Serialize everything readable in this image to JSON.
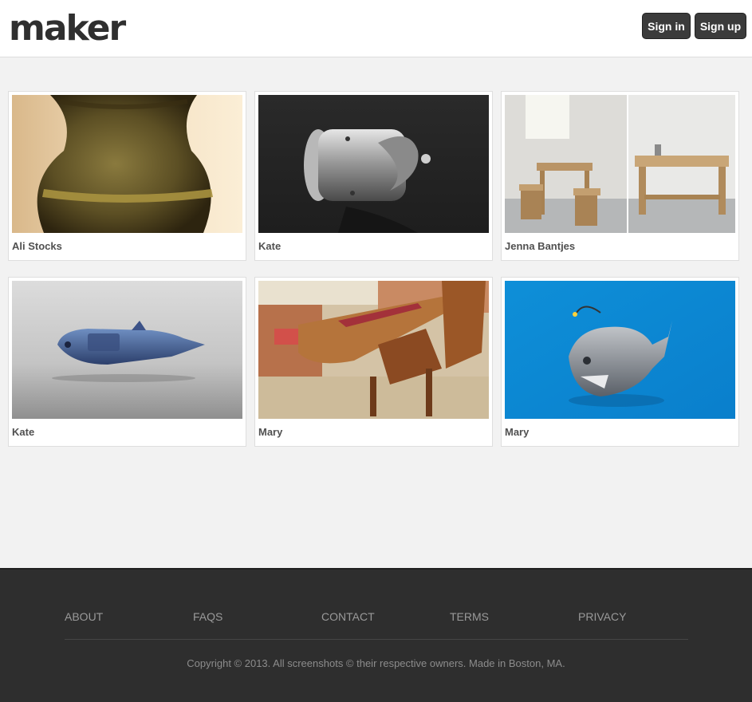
{
  "header": {
    "logo": "maker",
    "signin_label": "Sign in",
    "signup_label": "Sign up"
  },
  "gallery": {
    "items": [
      {
        "author": "Ali Stocks",
        "image": "pottery-vase"
      },
      {
        "author": "Kate",
        "image": "metal-propeller-part"
      },
      {
        "author": "Jenna Bantjes",
        "image": "wooden-table-and-stools"
      },
      {
        "author": "Kate",
        "image": "robotic-fish-model"
      },
      {
        "author": "Mary",
        "image": "dining-table-and-chairs"
      },
      {
        "author": "Mary",
        "image": "metal-anglerfish-model"
      }
    ]
  },
  "footer": {
    "links": [
      "ABOUT",
      "FAQS",
      "CONTACT",
      "TERMS",
      "PRIVACY"
    ],
    "copyright": "Copyright © 2013. All screenshots © their respective owners. Made in Boston, MA."
  }
}
